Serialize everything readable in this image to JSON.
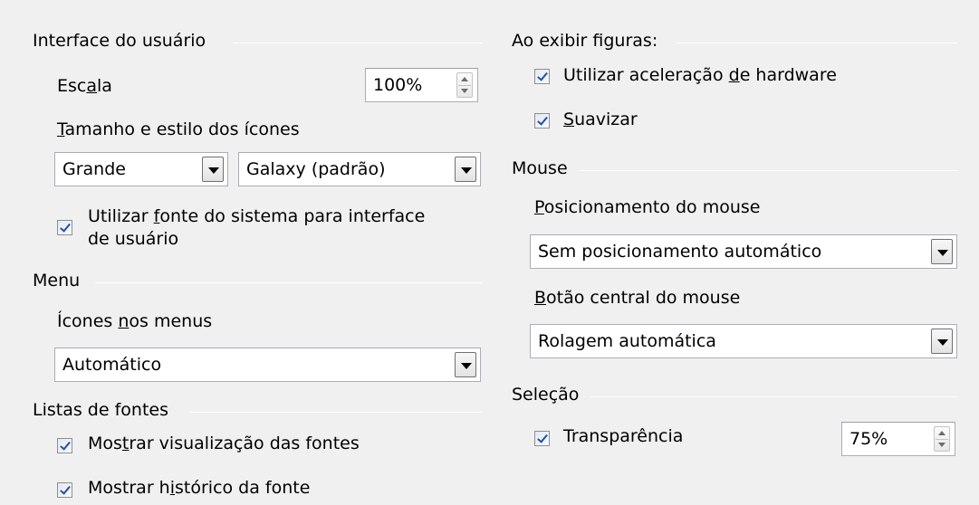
{
  "left": {
    "ui_section": {
      "title": "Interface do usuário",
      "scale": {
        "label_pre": "Esc",
        "label_u": "a",
        "label_post": "la",
        "value": "100%"
      },
      "icons": {
        "label_u": "T",
        "label_post": "amanho e estilo dos ícones",
        "size_value": "Grande",
        "style_value": "Galaxy (padrão)"
      },
      "system_font": {
        "line1_pre": "Utilizar ",
        "line1_u": "f",
        "line1_post": "onte do sistema para interface",
        "line2": "de usuário",
        "checked": true
      }
    },
    "menu_section": {
      "title": "Menu",
      "icons_in_menus": {
        "label_pre": "Ícones ",
        "label_u": "n",
        "label_post": "os menus",
        "value": "Automático"
      }
    },
    "font_lists_section": {
      "title": "Listas de fontes",
      "preview": {
        "label_pre": "Mos",
        "label_u": "t",
        "label_post": "rar visualização das fontes",
        "checked": true
      },
      "history": {
        "label_pre": "Mostrar h",
        "label_u": "i",
        "label_post": "stórico da fonte",
        "checked": true
      }
    }
  },
  "right": {
    "figures_section": {
      "title": "Ao exibir figuras:",
      "hw_accel": {
        "label_pre": "Utilizar aceleração ",
        "label_u": "d",
        "label_post": "e hardware",
        "checked": true
      },
      "smooth": {
        "label_u": "S",
        "label_post": "uavizar",
        "checked": true
      }
    },
    "mouse_section": {
      "title": "Mouse",
      "positioning": {
        "label_u": "P",
        "label_post": "osicionamento do mouse",
        "value": "Sem posicionamento automático"
      },
      "middle_button": {
        "label_u": "B",
        "label_post": "otão central do mouse",
        "value": "Rolagem automática"
      }
    },
    "selection_section": {
      "title": "Seleção",
      "transparency": {
        "label": "Transparência",
        "value": "75%",
        "checked": true
      }
    }
  },
  "colors": {
    "background": "#f0f0f0",
    "checkmark": "#2b4d9e",
    "border": "#abadb3"
  }
}
